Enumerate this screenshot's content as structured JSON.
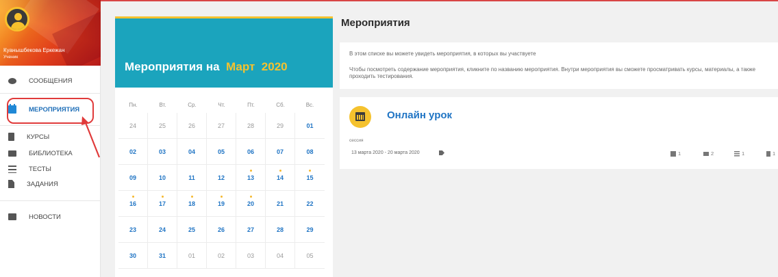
{
  "user": {
    "name": "Куанышбекова Еркежан",
    "role": "Ученик"
  },
  "nav": {
    "messages": "СООБЩЕНИЯ",
    "events": "МЕРОПРИЯТИЯ",
    "courses": "КУРСЫ",
    "library": "БИБЛИОТЕКА",
    "tests": "ТЕСТЫ",
    "tasks": "ЗАДАНИЯ",
    "news": "НОВОСТИ"
  },
  "calendar": {
    "title_prefix": "Мероприятия на",
    "month": "Март",
    "year": "2020",
    "weekdays": [
      "Пн.",
      "Вт.",
      "Ср.",
      "Чт.",
      "Пт.",
      "Сб.",
      "Вс."
    ],
    "weeks": [
      [
        {
          "d": "24",
          "m": true
        },
        {
          "d": "25",
          "m": true
        },
        {
          "d": "26",
          "m": true
        },
        {
          "d": "27",
          "m": true
        },
        {
          "d": "28",
          "m": true
        },
        {
          "d": "29",
          "m": true
        },
        {
          "d": "01"
        }
      ],
      [
        {
          "d": "02"
        },
        {
          "d": "03"
        },
        {
          "d": "04"
        },
        {
          "d": "05"
        },
        {
          "d": "06"
        },
        {
          "d": "07"
        },
        {
          "d": "08"
        }
      ],
      [
        {
          "d": "09"
        },
        {
          "d": "10"
        },
        {
          "d": "11"
        },
        {
          "d": "12"
        },
        {
          "d": "13",
          "e": true
        },
        {
          "d": "14",
          "e": true
        },
        {
          "d": "15",
          "e": true
        }
      ],
      [
        {
          "d": "16",
          "e": true
        },
        {
          "d": "17",
          "e": true
        },
        {
          "d": "18",
          "e": true
        },
        {
          "d": "19",
          "e": true
        },
        {
          "d": "20",
          "e": true
        },
        {
          "d": "21"
        },
        {
          "d": "22"
        }
      ],
      [
        {
          "d": "23"
        },
        {
          "d": "24"
        },
        {
          "d": "25"
        },
        {
          "d": "26"
        },
        {
          "d": "27"
        },
        {
          "d": "28"
        },
        {
          "d": "29"
        }
      ],
      [
        {
          "d": "30"
        },
        {
          "d": "31"
        },
        {
          "d": "01",
          "m": true
        },
        {
          "d": "02",
          "m": true
        },
        {
          "d": "03",
          "m": true
        },
        {
          "d": "04",
          "m": true
        },
        {
          "d": "05",
          "m": true
        }
      ]
    ]
  },
  "main": {
    "title": "Мероприятия",
    "info_line1": "В этом списке вы можете увидеть мероприятия, в которых вы участвуете",
    "info_line2": "Чтобы посмотреть содержание мероприятия, кликните по названию мероприятия. Внутри мероприятия вы сможете просматривать курсы, материалы, а также проходить тестирования."
  },
  "event": {
    "title": "Онлайн урок",
    "type": "сессия",
    "dates": "13 марта 2020 - 20 марта 2020",
    "stats": {
      "courses": "1",
      "folders": "2",
      "tests": "1",
      "tasks": "1"
    }
  },
  "colors": {
    "accent": "#1ba4bd",
    "highlight": "#f5c22e",
    "link": "#1f74c4",
    "annotation": "#e03a3a"
  },
  "icons": [
    "chat-icon",
    "calendar-icon",
    "book-icon",
    "folder-icon",
    "list-icon",
    "document-icon",
    "news-icon",
    "tag-icon"
  ]
}
